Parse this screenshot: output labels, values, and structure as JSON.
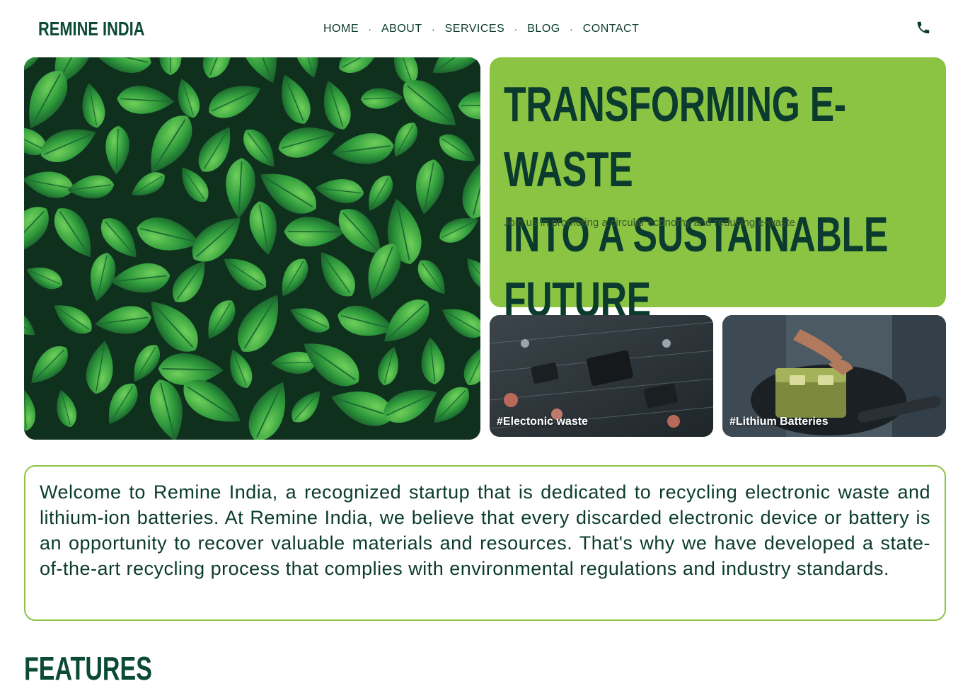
{
  "brand": {
    "name": "REMINE INDIA"
  },
  "nav": {
    "items": [
      "HOME",
      "ABOUT",
      "SERVICES",
      "BLOG",
      "CONTACT"
    ],
    "separator": "·",
    "phone_icon": "phone-icon"
  },
  "hero": {
    "title_line1": "TRANSFORMING E-WASTE",
    "title_line2": "INTO A SUSTAINABLE FUTURE",
    "subtitle": "Join us in promoting a circular economy and reducing e-waste",
    "tiles": [
      {
        "tag": "#Electonic waste"
      },
      {
        "tag": "#Lithium Batteries"
      }
    ]
  },
  "welcome": {
    "text": "Welcome to Remine India, a recognized startup that is dedicated to recycling electronic waste and lithium-ion batteries. At Remine India, we believe that every discarded electronic device or battery is an opportunity to recover valuable materials and resources. That's why we have developed a state-of-the-art recycling process that complies with environmental regulations and industry standards."
  },
  "features": {
    "heading": "FEATURES"
  },
  "colors": {
    "brand_dark": "#0b3b2e",
    "accent_green": "#8bc443",
    "background": "#ffffff"
  }
}
